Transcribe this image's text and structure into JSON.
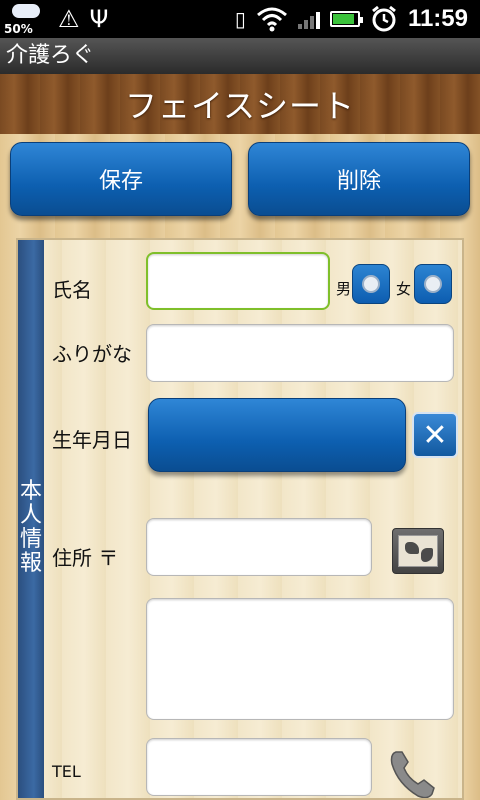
{
  "status_bar": {
    "battery_left_text": "50%",
    "time": "11:59",
    "battery_level": 0.8,
    "icons": [
      "weather-cloud-icon",
      "alert-triangle-icon",
      "usb-icon",
      "vibrate-icon",
      "wifi-icon",
      "signal-icon",
      "battery-icon",
      "alarm-clock-icon"
    ]
  },
  "app": {
    "title": "介護ろぐ"
  },
  "header": {
    "title": "フェイスシート"
  },
  "toolbar": {
    "save_label": "保存",
    "delete_label": "削除"
  },
  "section": {
    "label": "本\n人\n情\n報"
  },
  "form": {
    "name": {
      "label": "氏名",
      "value": ""
    },
    "gender": {
      "male_label": "男",
      "female_label": "女"
    },
    "furigana": {
      "label": "ふりがな",
      "value": ""
    },
    "birthdate": {
      "label": "生年月日",
      "value": ""
    },
    "address": {
      "label": "住所 〒",
      "postal_value": "",
      "address_value": ""
    },
    "tel": {
      "label": "TEL",
      "value": ""
    }
  },
  "colors": {
    "button_blue": "#0d5fb0",
    "focus_green": "#7fbf2a",
    "section_blue": "#2b4f7f",
    "wood_dark": "#7a4a22",
    "wood_light": "#e3c792"
  }
}
